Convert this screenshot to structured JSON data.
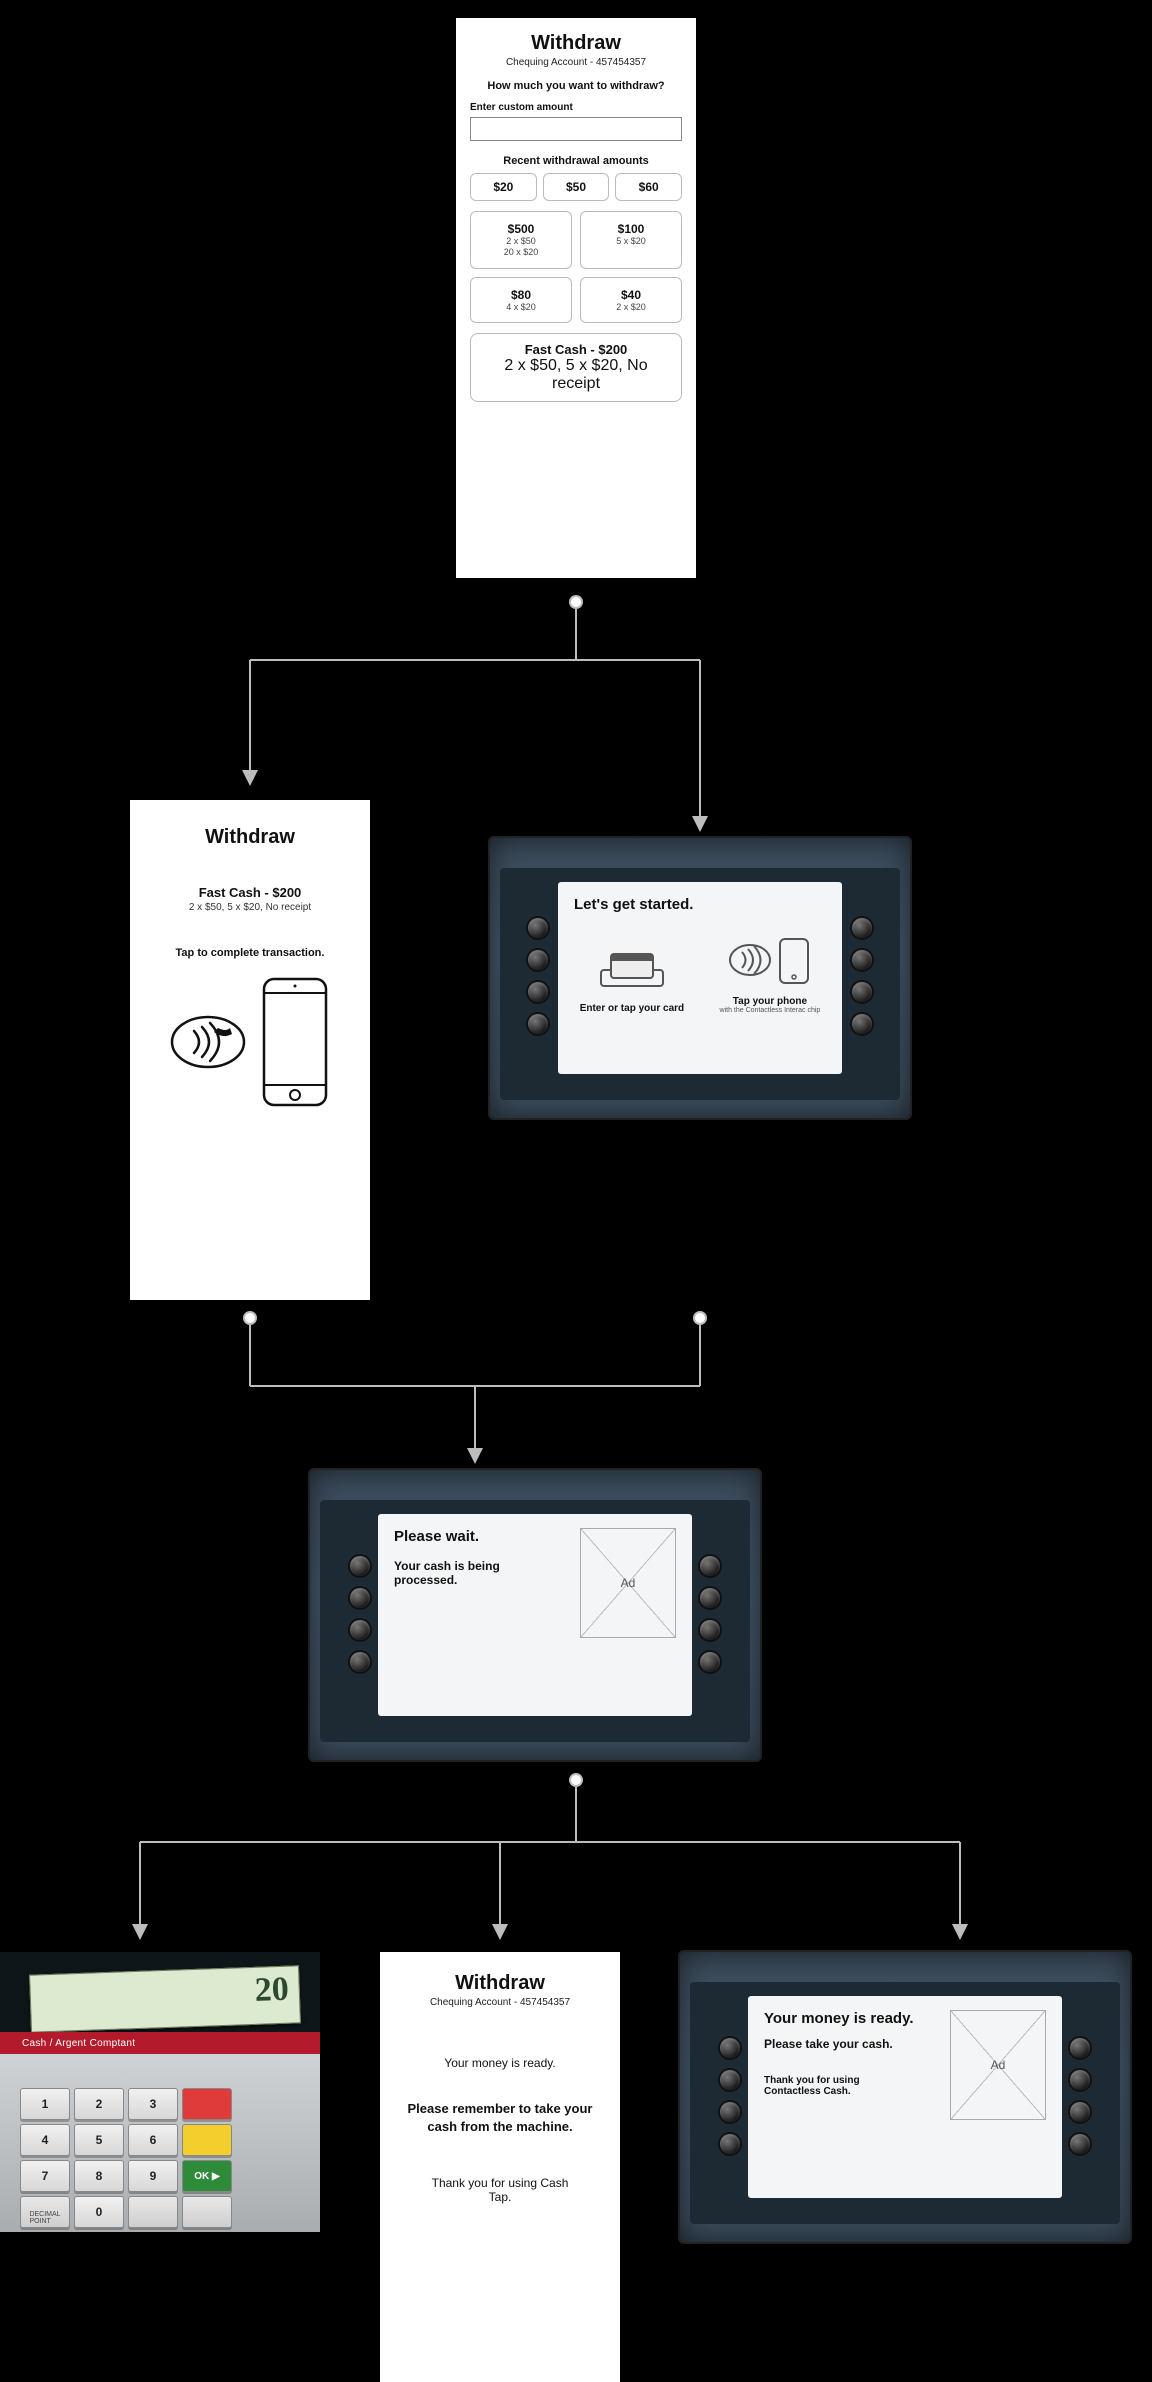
{
  "screen1": {
    "title": "Withdraw",
    "account": "Chequing Account - 457454357",
    "question": "How much you want to withdraw?",
    "custom_label": "Enter custom amount",
    "recent_label": "Recent withdrawal amounts",
    "recent": [
      "$20",
      "$50",
      "$60"
    ],
    "opts": [
      {
        "amt": "$500",
        "d1": "2 x $50",
        "d2": "20 x $20"
      },
      {
        "amt": "$100",
        "d1": "5 x $20",
        "d2": ""
      },
      {
        "amt": "$80",
        "d1": "4 x $20",
        "d2": ""
      },
      {
        "amt": "$40",
        "d1": "2 x $20",
        "d2": ""
      }
    ],
    "fast": {
      "amt": "Fast Cash - $200",
      "d": "2 x $50, 5 x $20, No receipt"
    }
  },
  "screen2": {
    "title": "Withdraw",
    "fast_amt": "Fast Cash - $200",
    "fast_d": "2 x $50, 5 x $20, No receipt",
    "tap": "Tap to complete transaction."
  },
  "atm1": {
    "title": "Let's get started.",
    "left": "Enter or tap your card",
    "right": "Tap your phone",
    "right_sub": "with the Contactless Interac chip"
  },
  "atm2": {
    "title": "Please wait.",
    "body": "Your cash is being processed.",
    "ad": "Ad"
  },
  "screen3": {
    "title": "Withdraw",
    "account": "Chequing Account - 457454357",
    "l1": "Your money is ready.",
    "l2": "Please remember to take your cash from the machine.",
    "l3": "Thank you for using Cash Tap."
  },
  "atm3": {
    "title": "Your money is ready.",
    "body": "Please take your cash.",
    "thanks": "Thank you for using Contactless Cash.",
    "ad": "Ad"
  },
  "cash": {
    "bill": "20",
    "label": "Cash / Argent Comptant",
    "enter": "OK"
  }
}
